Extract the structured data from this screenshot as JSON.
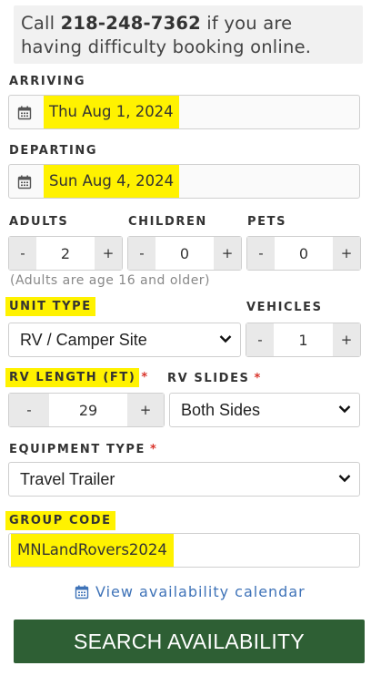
{
  "notice": {
    "prefix": "Call ",
    "phone": "218-248-7362",
    "suffix": " if you are having difficulty booking online."
  },
  "arriving": {
    "label": "ARRIVING",
    "value": "Thu Aug 1, 2024"
  },
  "departing": {
    "label": "DEPARTING",
    "value": "Sun Aug 4, 2024"
  },
  "adults": {
    "label": "ADULTS",
    "value": "2"
  },
  "children": {
    "label": "CHILDREN",
    "value": "0"
  },
  "pets": {
    "label": "PETS",
    "value": "0"
  },
  "stepper": {
    "minus": "-",
    "plus": "+"
  },
  "adults_hint": "(Adults are age 16 and older)",
  "unit_type": {
    "label": "UNIT TYPE",
    "value": "RV / Camper Site"
  },
  "vehicles": {
    "label": "VEHICLES",
    "value": "1"
  },
  "rv_length": {
    "label": "RV LENGTH (FT)",
    "required": "*",
    "value": "29"
  },
  "rv_slides": {
    "label": "RV SLIDES",
    "required": "*",
    "value": "Both Sides"
  },
  "equipment_type": {
    "label": "EQUIPMENT TYPE",
    "required": "*",
    "value": "Travel Trailer"
  },
  "group_code": {
    "label": "GROUP CODE",
    "value": "MNLandRovers2024"
  },
  "calendar_link": "View availability calendar",
  "search_button": "SEARCH AVAILABILITY",
  "colors": {
    "highlight": "#fff200",
    "button": "#2e5f34",
    "link": "#3f73b8",
    "required": "#d9342b"
  }
}
